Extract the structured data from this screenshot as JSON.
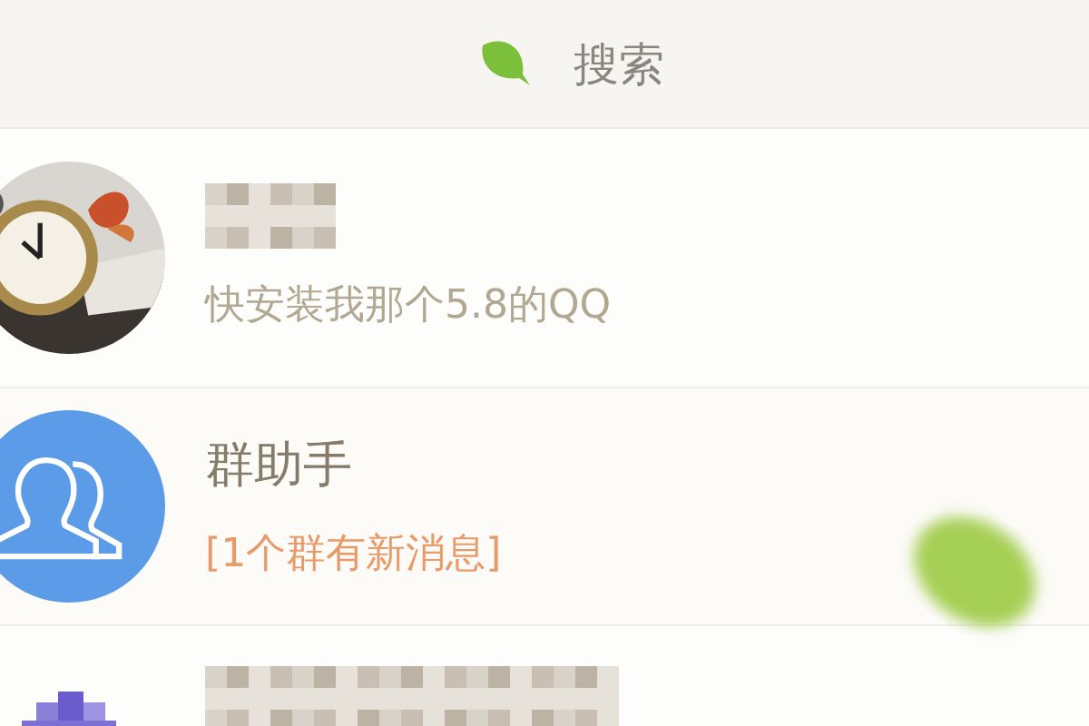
{
  "search_bar": {
    "label": "搜索"
  },
  "conversations": [
    {
      "name_hidden": true,
      "preview": "快安装我那个5.8的QQ",
      "notice": false
    },
    {
      "avatar": {
        "kind": "group"
      },
      "name": "群助手",
      "name_hidden": false,
      "preview": "[1个群有新消息]",
      "notice": true
    },
    {
      "avatar": {
        "kind": "pixelated"
      },
      "name_hidden": true,
      "notice": false
    }
  ]
}
